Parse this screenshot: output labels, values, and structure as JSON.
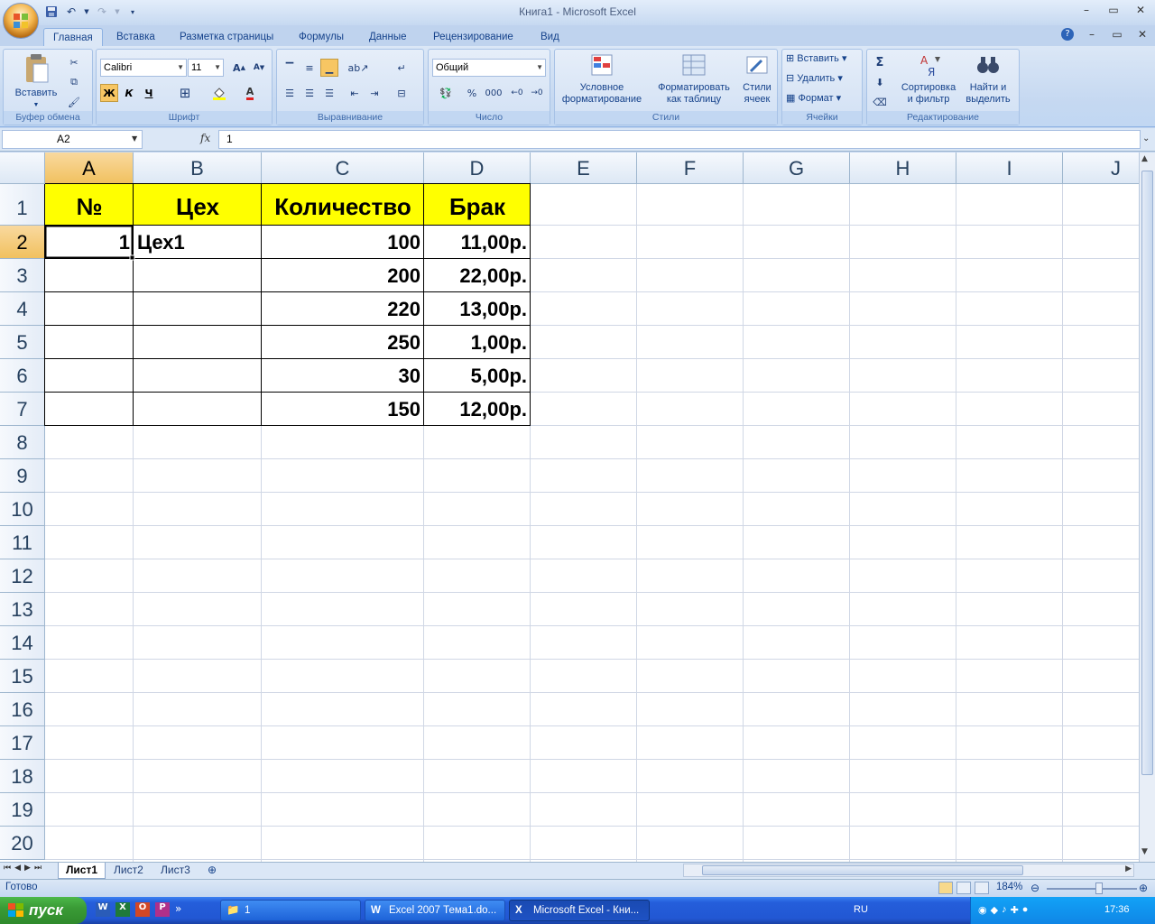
{
  "window": {
    "title": "Книга1 - Microsoft Excel"
  },
  "ribbon": {
    "tabs": [
      "Главная",
      "Вставка",
      "Разметка страницы",
      "Формулы",
      "Данные",
      "Рецензирование",
      "Вид"
    ],
    "clipboard": {
      "paste": "Вставить",
      "label": "Буфер обмена"
    },
    "font": {
      "name": "Calibri",
      "size": "11",
      "bold": "Ж",
      "italic": "К",
      "underline": "Ч",
      "label": "Шрифт"
    },
    "alignment": {
      "label": "Выравнивание"
    },
    "number": {
      "format": "Общий",
      "percent": "%",
      "thousands": "000",
      "label": "Число"
    },
    "styles": {
      "conditional_1": "Условное",
      "conditional_2": "форматирование",
      "as_table_1": "Форматировать",
      "as_table_2": "как таблицу",
      "cell_styles_1": "Стили",
      "cell_styles_2": "ячеек",
      "label": "Стили"
    },
    "cells": {
      "insert": "Вставить",
      "delete": "Удалить",
      "format": "Формат",
      "label": "Ячейки"
    },
    "editing": {
      "sigma": "Σ",
      "sort_1": "Сортировка",
      "sort_2": "и фильтр",
      "find_1": "Найти и",
      "find_2": "выделить",
      "label": "Редактирование"
    }
  },
  "formula_bar": {
    "name_box": "A2",
    "fx": "fx",
    "value": "1"
  },
  "sheet": {
    "columns": [
      "A",
      "B",
      "C",
      "D",
      "E",
      "F",
      "G",
      "H",
      "I",
      "J"
    ],
    "rows": [
      "1",
      "2",
      "3",
      "4",
      "5",
      "6",
      "7",
      "8",
      "9",
      "10",
      "11",
      "12",
      "13",
      "14",
      "15",
      "16",
      "17",
      "18",
      "19",
      "20"
    ],
    "selected_cell": "A2",
    "header_fill": "#ffff00",
    "headers": [
      "№",
      "Цех",
      "Количество",
      "Брак"
    ],
    "data": [
      [
        "1",
        "Цех1",
        "100",
        "11,00р."
      ],
      [
        "",
        "",
        "200",
        "22,00р."
      ],
      [
        "",
        "",
        "220",
        "13,00р."
      ],
      [
        "",
        "",
        "250",
        "1,00р."
      ],
      [
        "",
        "",
        "30",
        "5,00р."
      ],
      [
        "",
        "",
        "150",
        "12,00р."
      ]
    ]
  },
  "sheet_tabs": [
    "Лист1",
    "Лист2",
    "Лист3"
  ],
  "status": {
    "ready": "Готово",
    "zoom": "184%"
  },
  "taskbar": {
    "start": "пуск",
    "items": [
      "1",
      "Excel 2007 Тема1.do...",
      "Microsoft Excel - Кни..."
    ],
    "lang": "RU",
    "clock": "17:36"
  }
}
